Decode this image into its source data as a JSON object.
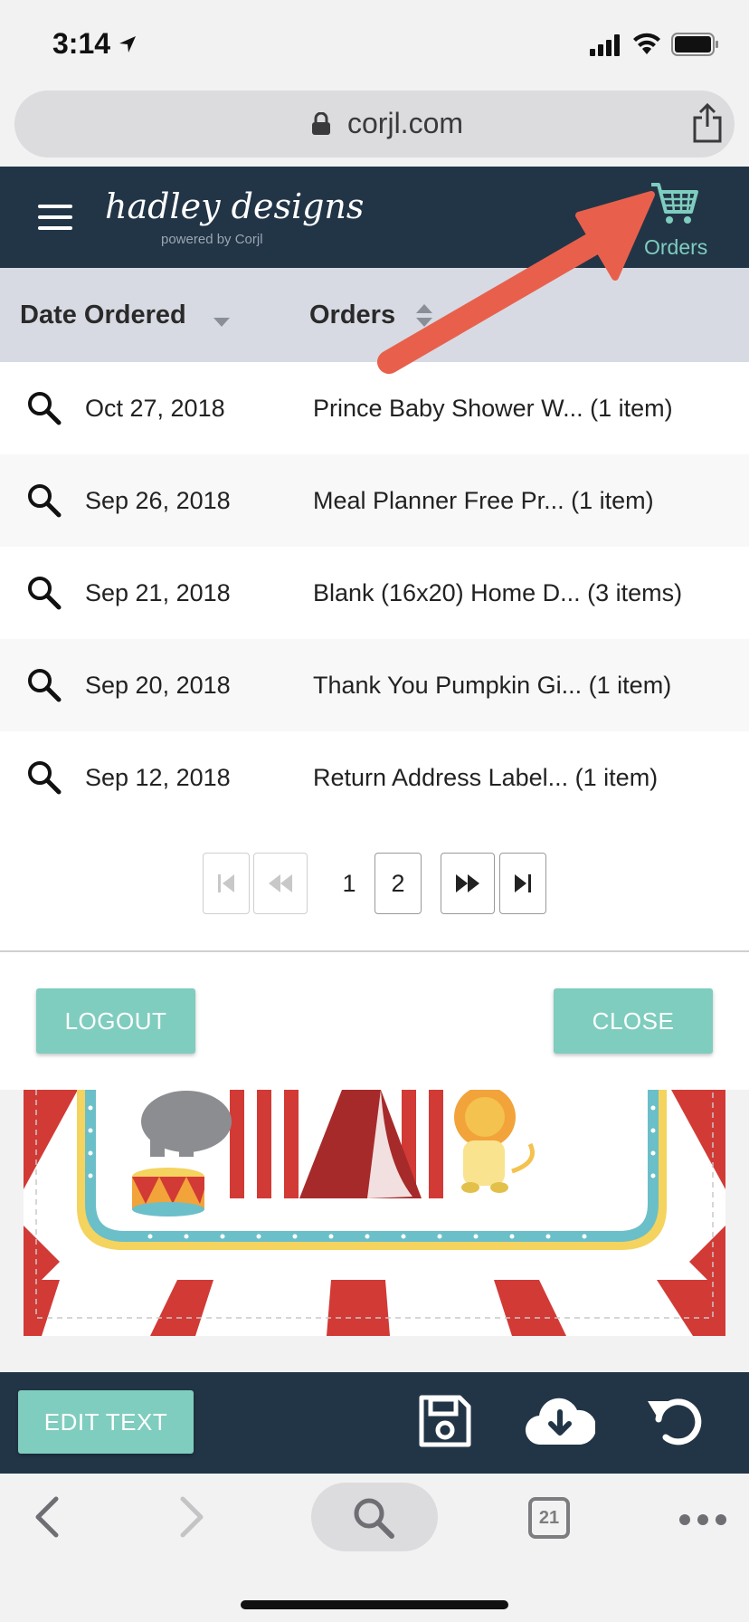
{
  "status_bar": {
    "time": "3:14"
  },
  "browser": {
    "url": "corjl.com",
    "tab_count": "21"
  },
  "header": {
    "brand_name": "hadley designs",
    "brand_sub": "powered by Corjl",
    "orders_label": "Orders"
  },
  "orders_table": {
    "col_date": "Date Ordered",
    "col_orders": "Orders",
    "rows": [
      {
        "date": "Oct 27, 2018",
        "order": "Prince Baby Shower W... (1 item)"
      },
      {
        "date": "Sep 26, 2018",
        "order": "Meal Planner Free Pr... (1 item)"
      },
      {
        "date": "Sep 21, 2018",
        "order": "Blank (16x20) Home D... (3 items)"
      },
      {
        "date": "Sep 20, 2018",
        "order": "Thank You Pumpkin Gi... (1 item)"
      },
      {
        "date": "Sep 12, 2018",
        "order": "Return Address Label... (1 item)"
      }
    ]
  },
  "pagination": {
    "page1": "1",
    "page2": "2",
    "current_page": 1
  },
  "modal_actions": {
    "logout": "LOGOUT",
    "close": "CLOSE"
  },
  "editor": {
    "edit_text": "EDIT TEXT"
  },
  "colors": {
    "navy": "#223547",
    "teal": "#7fcdbe",
    "header_gray": "#d7dae3",
    "annotation_arrow": "#e8604c",
    "circus_red": "#d23a36",
    "circus_blue": "#6bbfc9",
    "circus_yellow": "#f4d35e"
  }
}
